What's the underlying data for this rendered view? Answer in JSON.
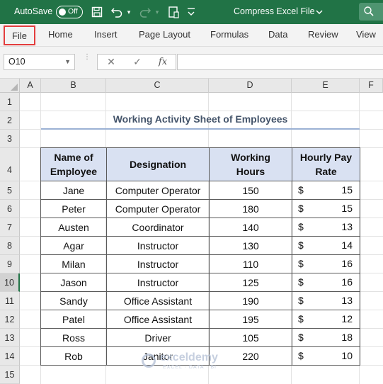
{
  "titlebar": {
    "autosave_label": "AutoSave",
    "autosave_state": "Off",
    "file_title": "Compress Excel File",
    "icons": [
      "save-icon",
      "undo-icon",
      "redo-icon",
      "clipboard-icon",
      "customize-icon"
    ]
  },
  "ribbon": {
    "tabs": [
      "File",
      "Home",
      "Insert",
      "Page Layout",
      "Formulas",
      "Data",
      "Review",
      "View"
    ]
  },
  "formula_bar": {
    "name_box": "O10",
    "cancel_symbol": "✕",
    "enter_symbol": "✓",
    "fx_symbol": "fx",
    "formula": ""
  },
  "grid": {
    "columns": [
      "A",
      "B",
      "C",
      "D",
      "E",
      "F"
    ],
    "rows": [
      "1",
      "2",
      "3",
      "4",
      "5",
      "6",
      "7",
      "8",
      "9",
      "10",
      "11",
      "12",
      "13",
      "14",
      "15"
    ],
    "selected_row": "10"
  },
  "sheet": {
    "title": "Working Activity Sheet of Employees",
    "headers": {
      "name": "Name of Employee",
      "designation": "Designation",
      "hours": "Working Hours",
      "rate": "Hourly Pay Rate"
    },
    "currency": "$",
    "rows": [
      {
        "name": "Jane",
        "designation": "Computer Operator",
        "hours": "150",
        "rate": "15"
      },
      {
        "name": "Peter",
        "designation": "Computer Operator",
        "hours": "180",
        "rate": "15"
      },
      {
        "name": "Austen",
        "designation": "Coordinator",
        "hours": "140",
        "rate": "13"
      },
      {
        "name": "Agar",
        "designation": "Instructor",
        "hours": "130",
        "rate": "14"
      },
      {
        "name": "Milan",
        "designation": "Instructor",
        "hours": "110",
        "rate": "16"
      },
      {
        "name": "Jason",
        "designation": "Instructor",
        "hours": "125",
        "rate": "16"
      },
      {
        "name": "Sandy",
        "designation": "Office Assistant",
        "hours": "190",
        "rate": "13"
      },
      {
        "name": "Patel",
        "designation": "Office Assistant",
        "hours": "195",
        "rate": "12"
      },
      {
        "name": "Ross",
        "designation": "Driver",
        "hours": "105",
        "rate": "18"
      },
      {
        "name": "Rob",
        "designation": "Janitor",
        "hours": "220",
        "rate": "10"
      }
    ]
  },
  "watermark": {
    "name": "exceldemy",
    "sub": "EXCEL · DATA · BI"
  }
}
